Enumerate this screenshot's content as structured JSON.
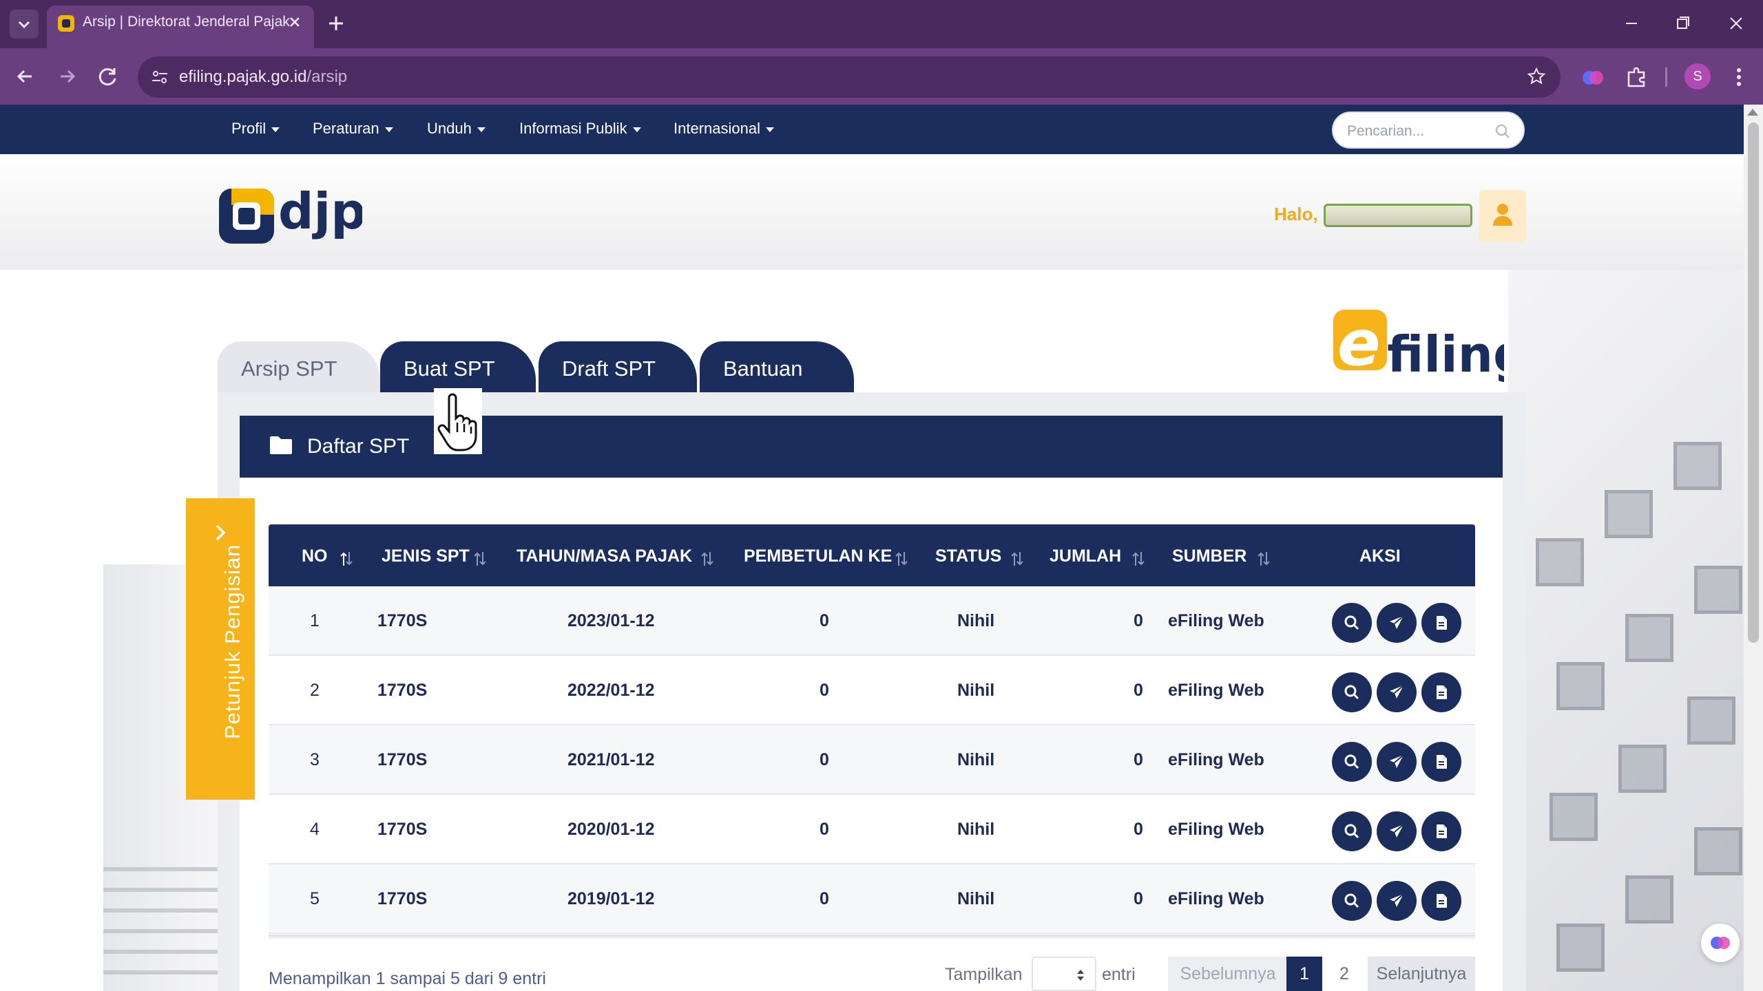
{
  "browser": {
    "tab_title": "Arsip | Direktorat Jenderal Pajak",
    "url_host": "efiling.pajak.go.id",
    "url_path": "/arsip",
    "profile_initial": "S"
  },
  "site_nav": {
    "items": [
      "Profil",
      "Peraturan",
      "Unduh",
      "Informasi Publik",
      "Internasional"
    ],
    "search_placeholder": "Pencarian..."
  },
  "header": {
    "logo_text": "djp",
    "greeting": "Halo,"
  },
  "efiling_logo": {
    "e": "e",
    "rest": "filing"
  },
  "tabs": [
    "Arsip SPT",
    "Buat SPT",
    "Draft SPT",
    "Bantuan"
  ],
  "panel": {
    "title": "Daftar SPT"
  },
  "side_tab": {
    "label": "Petunjuk Pengisian"
  },
  "table": {
    "headers": [
      "NO",
      "JENIS SPT",
      "TAHUN/MASA PAJAK",
      "PEMBETULAN KE",
      "STATUS",
      "JUMLAH",
      "SUMBER",
      "AKSI"
    ],
    "rows": [
      {
        "no": "1",
        "jenis": "1770S",
        "tahun": "2023/01-12",
        "pembetulan": "0",
        "status": "Nihil",
        "jumlah": "0",
        "sumber": "eFiling Web"
      },
      {
        "no": "2",
        "jenis": "1770S",
        "tahun": "2022/01-12",
        "pembetulan": "0",
        "status": "Nihil",
        "jumlah": "0",
        "sumber": "eFiling Web"
      },
      {
        "no": "3",
        "jenis": "1770S",
        "tahun": "2021/01-12",
        "pembetulan": "0",
        "status": "Nihil",
        "jumlah": "0",
        "sumber": "eFiling Web"
      },
      {
        "no": "4",
        "jenis": "1770S",
        "tahun": "2020/01-12",
        "pembetulan": "0",
        "status": "Nihil",
        "jumlah": "0",
        "sumber": "eFiling Web"
      },
      {
        "no": "5",
        "jenis": "1770S",
        "tahun": "2019/01-12",
        "pembetulan": "0",
        "status": "Nihil",
        "jumlah": "0",
        "sumber": "eFiling Web"
      }
    ]
  },
  "pagination": {
    "info": "Menampilkan 1 sampai 5 dari 9 entri",
    "show_label": "Tampilkan",
    "entries_label": "entri",
    "prev": "Sebelumnya",
    "pages": [
      "1",
      "2"
    ],
    "next": "Selanjutnya"
  },
  "colors": {
    "navy": "#1b2d5c",
    "accent_yellow": "#f7b31a",
    "browser_purple": "#6a3f80"
  }
}
